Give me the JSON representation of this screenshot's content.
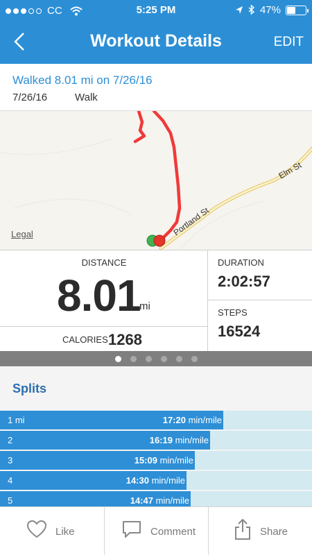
{
  "status_bar": {
    "carrier": "CC",
    "time": "5:25 PM",
    "battery": "47%",
    "battery_level": 0.47
  },
  "nav": {
    "title": "Workout Details",
    "edit_label": "EDIT"
  },
  "workout": {
    "title": "Walked 8.01 mi on 7/26/16",
    "date": "7/26/16",
    "type": "Walk"
  },
  "map": {
    "legal": "Legal",
    "streets": [
      "Portland St",
      "Elm St"
    ],
    "route_color": "#f03a3a",
    "start_color": "#3fb34f",
    "end_color": "#e2372a"
  },
  "stats": {
    "distance_label": "DISTANCE",
    "distance_value": "8.01",
    "distance_unit": "mi",
    "calories_label": "CALORIES",
    "calories_value": "1268",
    "duration_label": "DURATION",
    "duration_value": "2:02:57",
    "steps_label": "STEPS",
    "steps_value": "16524"
  },
  "pager": {
    "pages": 6,
    "active": 0
  },
  "splits": {
    "title": "Splits",
    "rows": [
      {
        "mile": "1 mi",
        "pace": "17:20",
        "unit": "min/mile",
        "pace_minutes": 17.33
      },
      {
        "mile": "2",
        "pace": "16:19",
        "unit": "min/mile",
        "pace_minutes": 16.32
      },
      {
        "mile": "3",
        "pace": "15:09",
        "unit": "min/mile",
        "pace_minutes": 15.15
      },
      {
        "mile": "4",
        "pace": "14:30",
        "unit": "min/mile",
        "pace_minutes": 14.5
      },
      {
        "mile": "5",
        "pace": "14:47",
        "unit": "min/mile",
        "pace_minutes": 14.78
      }
    ]
  },
  "actions": {
    "like": "Like",
    "comment": "Comment",
    "share": "Share"
  },
  "colors": {
    "accent": "#2c8fd6",
    "split_bar": "#2e8fd6",
    "split_track": "#d2eaf0"
  }
}
